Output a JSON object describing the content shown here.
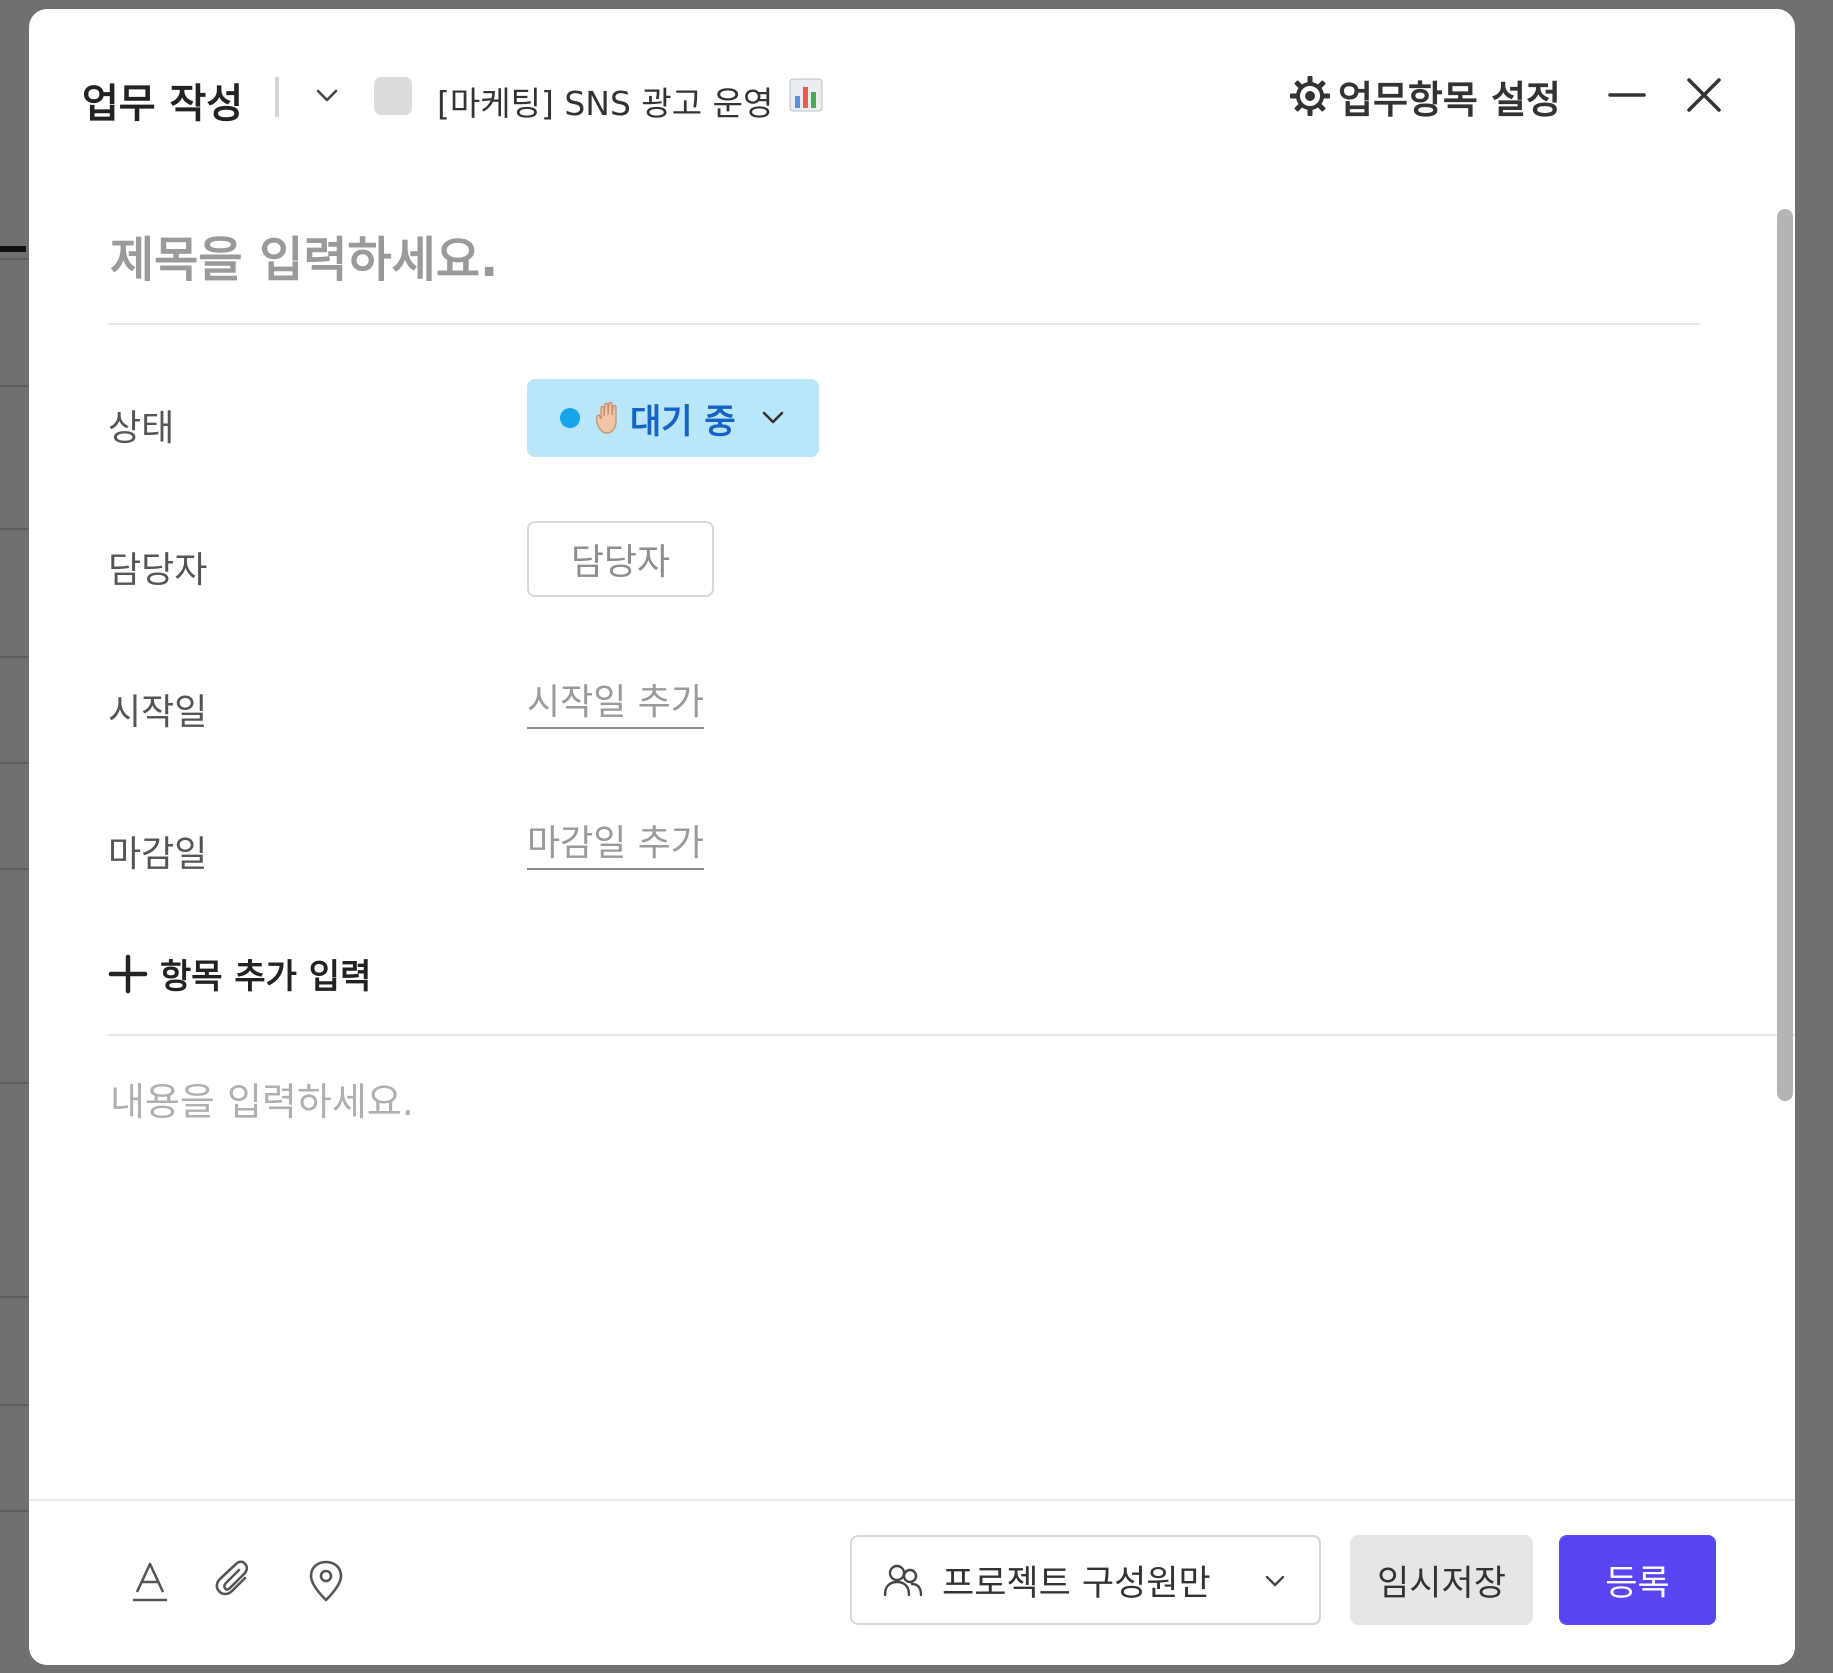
{
  "header": {
    "title": "업무 작성",
    "project_name": "[마케팅] SNS 광고 운영",
    "project_emoji": "bar-chart-emoji",
    "settings_label": "업무항목 설정",
    "icons": {
      "dropdown": "chevron-down-icon",
      "settings": "gear-icon",
      "minimize": "minimize-icon",
      "close": "close-icon"
    }
  },
  "form": {
    "title_placeholder": "제목을 입력하세요.",
    "status": {
      "label": "상태",
      "value": "대기 중",
      "dot_color": "#18a4ea",
      "background_color": "#b9e6f8",
      "text_color": "#1763c5",
      "emoji": "raised-hand-emoji"
    },
    "assignee": {
      "label": "담당자",
      "button_label": "담당자"
    },
    "start_date": {
      "label": "시작일",
      "link_label": "시작일 추가"
    },
    "due_date": {
      "label": "마감일",
      "link_label": "마감일 추가"
    },
    "add_field_label": "항목 추가 입력",
    "content_placeholder": "내용을 입력하세요."
  },
  "footer": {
    "toolbar_icons": [
      "text-format-icon",
      "attachment-icon",
      "location-pin-icon"
    ],
    "visibility": {
      "value": "프로젝트 구성원만",
      "icon": "people-icon"
    },
    "draft_label": "임시저장",
    "submit_label": "등록",
    "submit_color": "#5a45f2"
  }
}
